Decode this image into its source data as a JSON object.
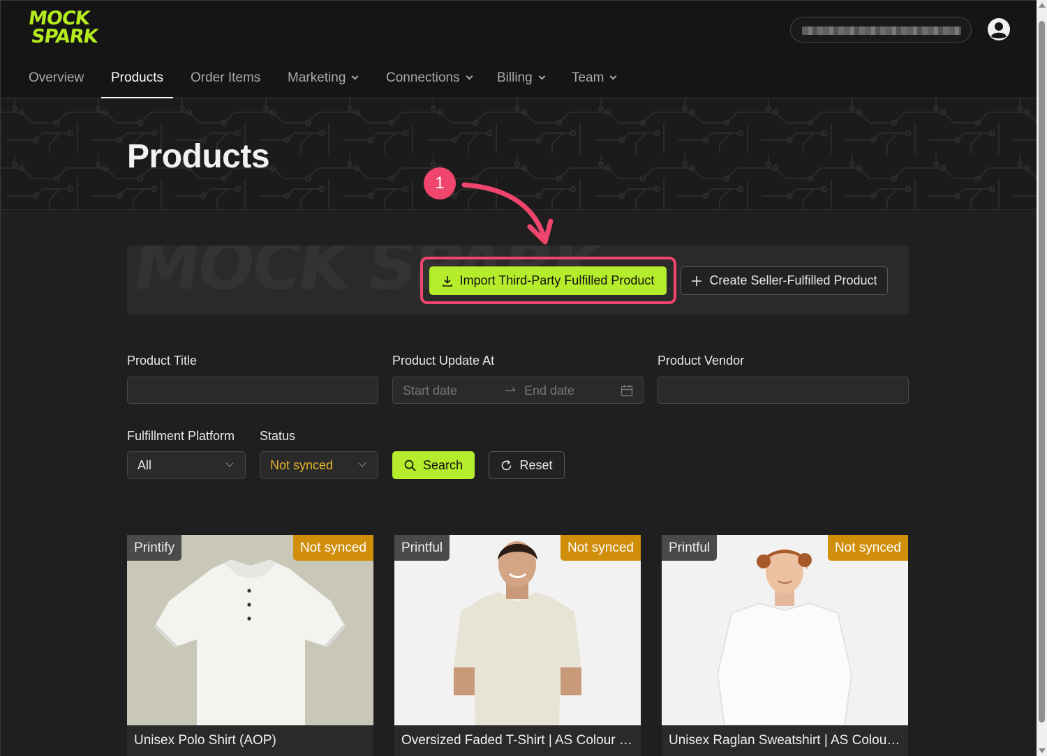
{
  "logo": {
    "line1": "MOCK",
    "line2": "SPARK"
  },
  "nav": {
    "items": [
      {
        "label": "Overview"
      },
      {
        "label": "Products"
      },
      {
        "label": "Order Items"
      },
      {
        "label": "Marketing"
      },
      {
        "label": "Connections"
      },
      {
        "label": "Billing"
      },
      {
        "label": "Team"
      }
    ],
    "active": "Products"
  },
  "page": {
    "title": "Products"
  },
  "actions": {
    "import_label": "Import Third-Party Fulfilled Product",
    "create_label": "Create Seller-Fulfilled Product",
    "watermark": "MOCK SPARK"
  },
  "annotation": {
    "step": "1"
  },
  "filters": {
    "title_label": "Product Title",
    "title_value": "",
    "updated_label": "Product Update At",
    "start_placeholder": "Start date",
    "end_placeholder": "End date",
    "vendor_label": "Product Vendor",
    "vendor_value": "",
    "platform_label": "Fulfillment Platform",
    "platform_value": "All",
    "status_label": "Status",
    "status_value": "Not synced",
    "search_label": "Search",
    "reset_label": "Reset"
  },
  "products": [
    {
      "platform": "Printify",
      "status": "Not synced",
      "title": "Unisex Polo Shirt (AOP)"
    },
    {
      "platform": "Printful",
      "status": "Not synced",
      "title": "Oversized Faded T-Shirt | AS Colour 5..."
    },
    {
      "platform": "Printful",
      "status": "Not synced",
      "title": "Unisex Raglan Sweatshirt | AS Colour ..."
    }
  ],
  "colors": {
    "accent": "#b5ec2b",
    "annotation": "#f0456c",
    "status_badge": "#d08e0b",
    "background": "#1f1f1f"
  }
}
